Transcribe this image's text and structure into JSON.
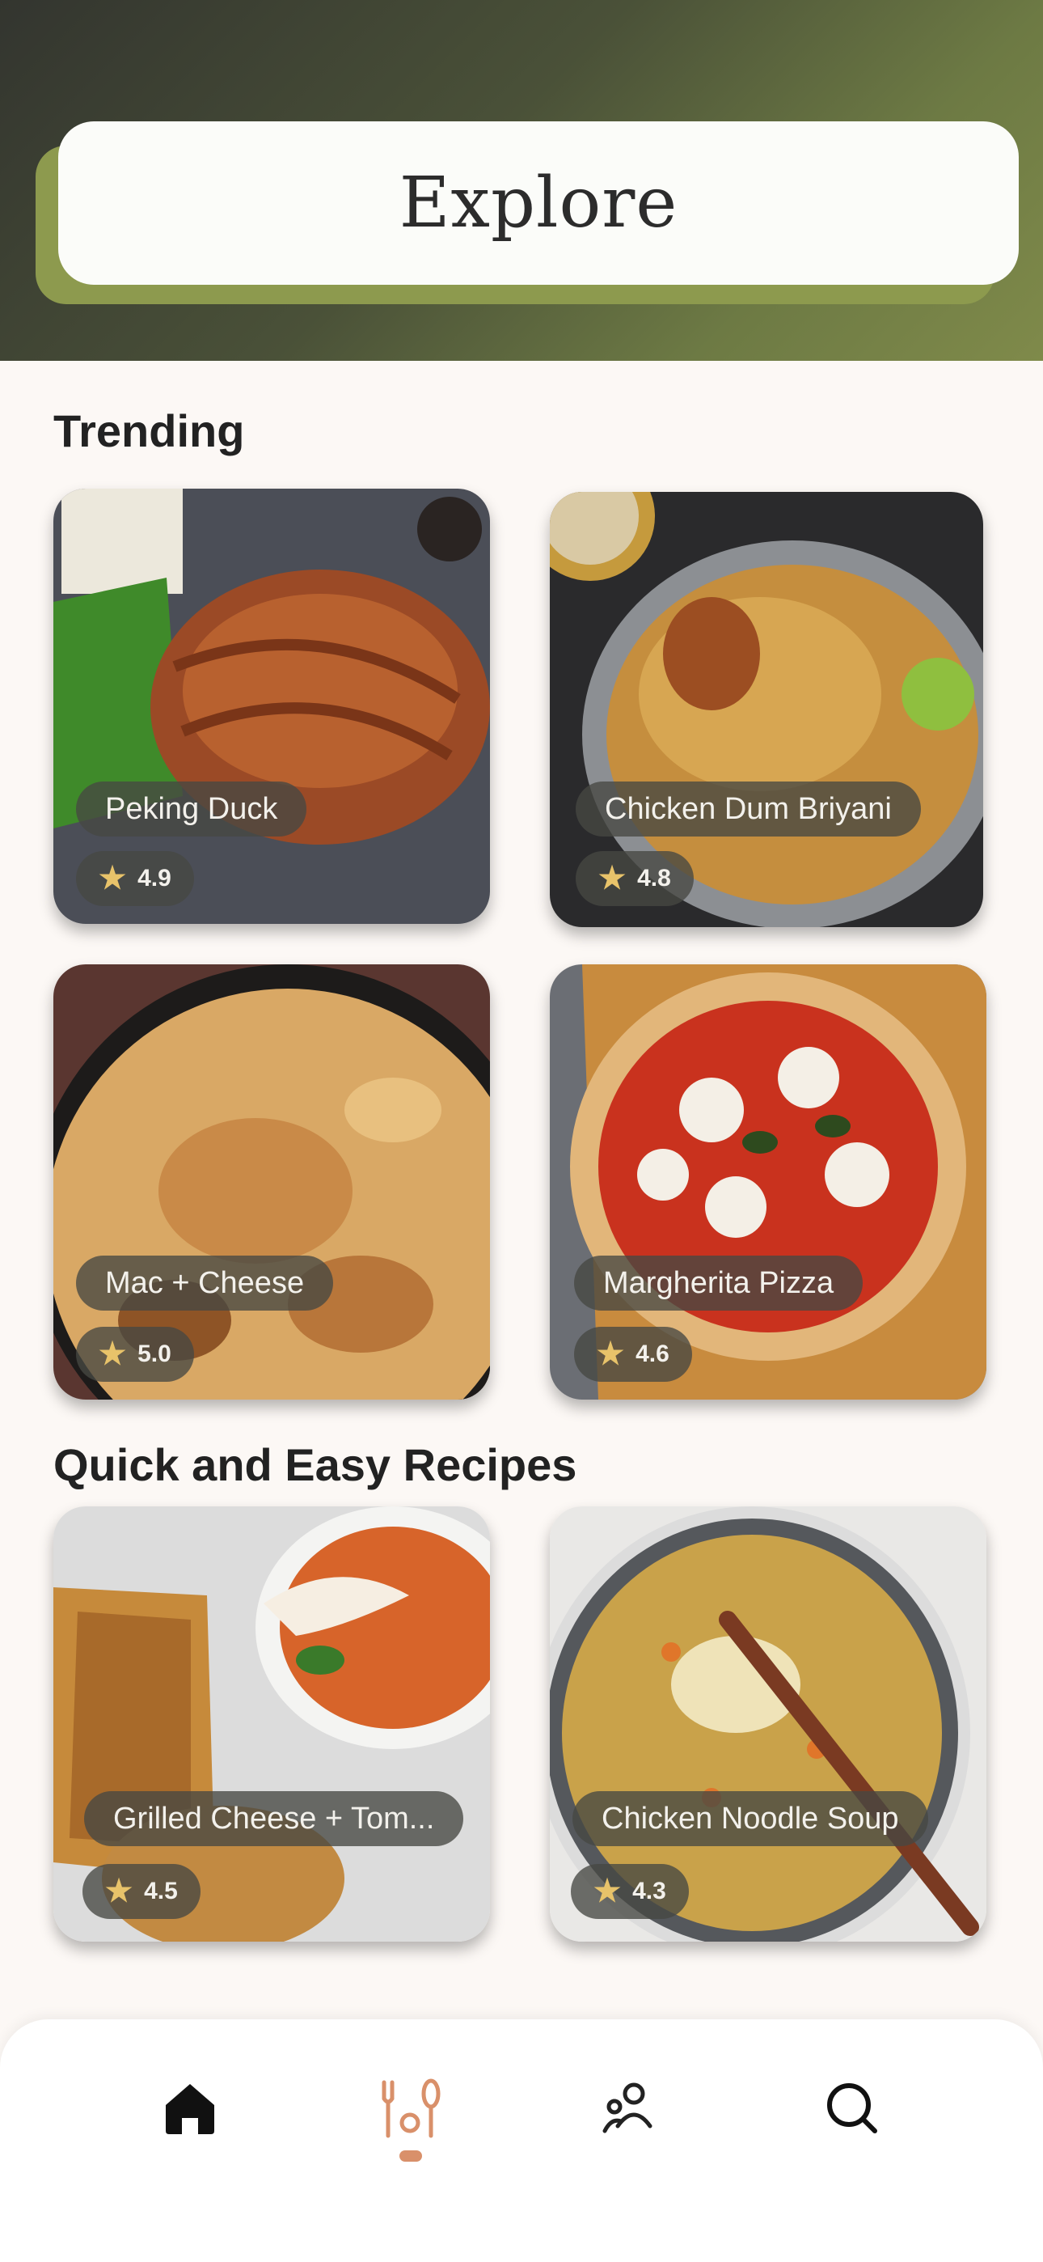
{
  "header": {
    "title": "Explore"
  },
  "sections": {
    "trending": {
      "title": "Trending",
      "cards": [
        {
          "name": "Peking Duck",
          "rating": "4.9"
        },
        {
          "name": "Chicken Dum Briyani",
          "rating": "4.8"
        },
        {
          "name": "Mac + Cheese",
          "rating": "5.0"
        },
        {
          "name": "Margherita Pizza",
          "rating": "4.6"
        }
      ]
    },
    "quick": {
      "title": "Quick and Easy Recipes",
      "cards": [
        {
          "name": "Grilled Cheese + Tom...",
          "rating": "4.5"
        },
        {
          "name": "Chicken Noodle Soup",
          "rating": "4.3"
        }
      ]
    }
  },
  "nav": {
    "items": [
      {
        "icon": "home-icon"
      },
      {
        "icon": "utensils-icon",
        "active": true
      },
      {
        "icon": "people-icon"
      },
      {
        "icon": "search-icon"
      }
    ],
    "accent": "#d9906a"
  },
  "colors": {
    "header_start": "#33352f",
    "header_end": "#7f8a4a",
    "background": "#fcf8f5",
    "star": "#e8c36a"
  }
}
